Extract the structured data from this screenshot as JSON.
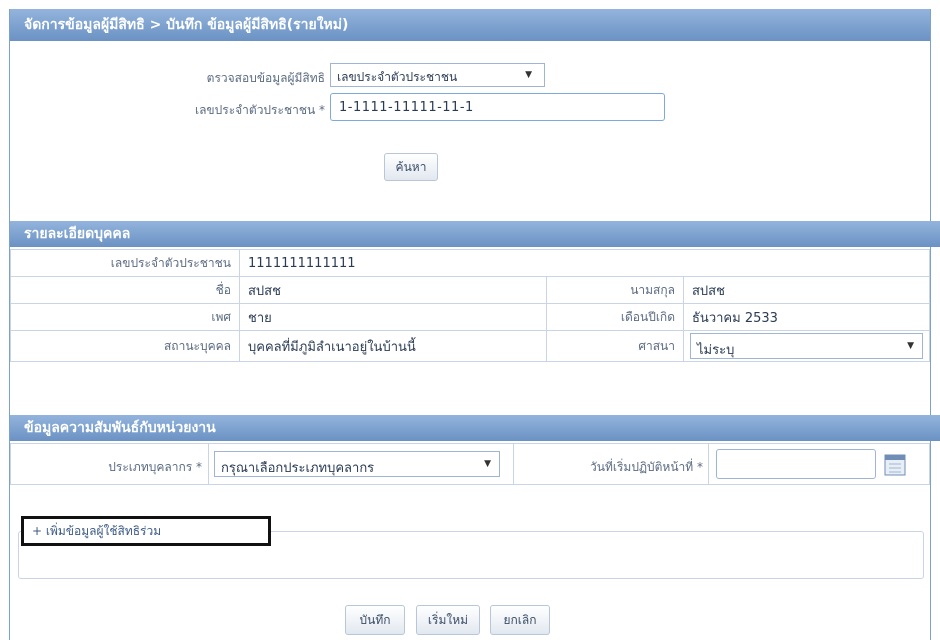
{
  "header": {
    "title": "จัดการข้อมูลผู้มีสิทธิ > บันทึก ข้อมูลผู้มีสิทธิ(รายใหม่)"
  },
  "search": {
    "check_label": "ตรวจสอบข้อมูลผู้มีสิทธิ",
    "check_value": "เลขประจำตัวประชาชน",
    "id_label": "เลขประจำตัวประชาชน *",
    "id_value": "1-1111-11111-11-1",
    "search_button": "ค้นหา"
  },
  "person": {
    "section_title": "รายละเอียดบุคคล",
    "id_label": "เลขประจำตัวประชาชน",
    "id_value": "1111111111111",
    "name_label": "ชื่อ",
    "name_value": "สปสช",
    "surname_label": "นามสกุล",
    "surname_value": "สปสช",
    "sex_label": "เพศ",
    "sex_value": "ชาย",
    "birth_label": "เดือนปีเกิด",
    "birth_value": "ธันวาคม 2533",
    "status_label": "สถานะบุคคล",
    "status_value": "บุคคลที่มีภูมิลำเนาอยู่ในบ้านนี้",
    "religion_label": "ศาสนา",
    "religion_value": "ไม่ระบุ"
  },
  "relation": {
    "section_title": "ข้อมูลความสัมพันธ์กับหน่วยงาน",
    "type_label": "ประเภทบุคลากร *",
    "type_value": "กรุณาเลือกประเภทบุคลากร",
    "start_label": "วันที่เริ่มปฏิบัติหน้าที่ *",
    "start_value": ""
  },
  "co_rights": {
    "label": "+ เพิ่มข้อมูลผู้ใช้สิทธิร่วม"
  },
  "footer": {
    "save": "บันทึก",
    "reset": "เริ่มใหม่",
    "cancel": "ยกเลิก"
  }
}
